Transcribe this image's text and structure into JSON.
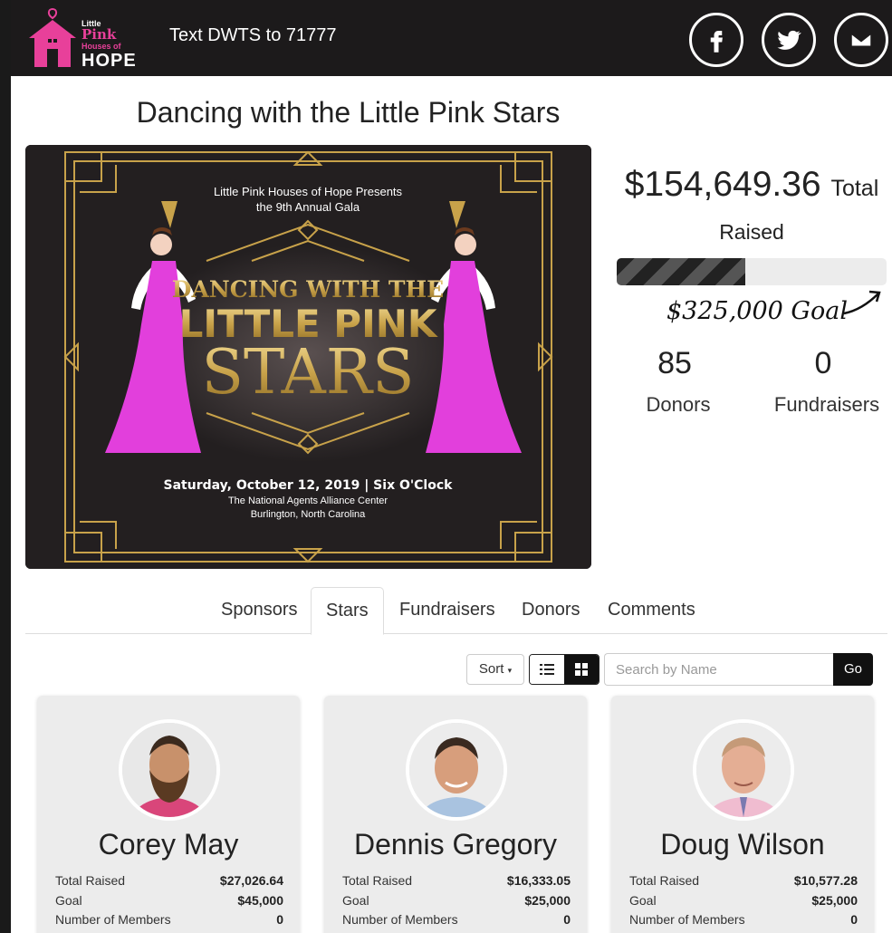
{
  "header": {
    "logo": {
      "line1": "Little",
      "line2": "Pink",
      "line3": "Houses of",
      "line4": "HOPE"
    },
    "text_cta": "Text DWTS to 71777",
    "social": [
      "facebook-icon",
      "twitter-icon",
      "email-icon"
    ],
    "colors": {
      "bar": "#1c1a1b",
      "pink": "#e8409a"
    }
  },
  "page": {
    "title": "Dancing with the Little Pink Stars"
  },
  "banner": {
    "presents": "Little Pink Houses of Hope Presents",
    "gala": "the 9th Annual Gala",
    "headline1": "DANCING WITH THE",
    "headline2": "LITTLE PINK",
    "headline3": "STARS",
    "date": "Saturday, October 12, 2019 | Six O'Clock",
    "venue": "The National Agents Alliance Center",
    "city": "Burlington, North Carolina"
  },
  "stats": {
    "total_amount": "$154,649.36",
    "total_word": "Total",
    "raised_word": "Raised",
    "progress_fraction": 0.476,
    "goal_text": "$325,000 Goal",
    "donors_count": "85",
    "donors_label": "Donors",
    "fundraisers_count": "0",
    "fundraisers_label": "Fundraisers"
  },
  "tabs": [
    {
      "label": "Sponsors",
      "active": false
    },
    {
      "label": "Stars",
      "active": true
    },
    {
      "label": "Fundraisers",
      "active": false
    },
    {
      "label": "Donors",
      "active": false
    },
    {
      "label": "Comments",
      "active": false
    }
  ],
  "toolbar": {
    "sort_label": "Sort",
    "search_placeholder": "Search by Name",
    "go_label": "Go"
  },
  "cards": [
    {
      "name": "Corey May",
      "total_label": "Total Raised",
      "total": "$27,026.64",
      "goal_label": "Goal",
      "goal": "$45,000",
      "members_label": "Number of Members",
      "members": "0"
    },
    {
      "name": "Dennis Gregory",
      "total_label": "Total Raised",
      "total": "$16,333.05",
      "goal_label": "Goal",
      "goal": "$25,000",
      "members_label": "Number of Members",
      "members": "0"
    },
    {
      "name": "Doug Wilson",
      "total_label": "Total Raised",
      "total": "$10,577.28",
      "goal_label": "Goal",
      "goal": "$25,000",
      "members_label": "Number of Members",
      "members": "0"
    }
  ]
}
